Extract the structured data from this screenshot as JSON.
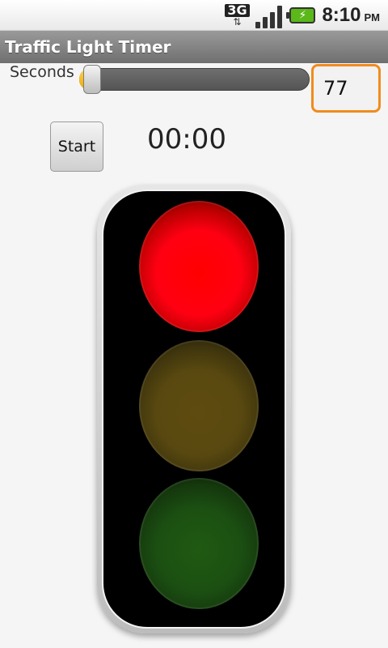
{
  "status_bar": {
    "network_type": "3G",
    "time": "8:10",
    "ampm": "PM",
    "icons": [
      "network-3g-icon",
      "signal-icon",
      "battery-charging-icon"
    ],
    "colors": {
      "battery": "#5ab818"
    }
  },
  "app": {
    "title": "Traffic Light Timer"
  },
  "controls": {
    "seconds_label": "Seconds",
    "seconds_value": "77",
    "slider_fraction": 0.02,
    "start_label": "Start",
    "timer_display": "00:00"
  },
  "traffic_light": {
    "active_lamp": "red",
    "lamps": [
      {
        "name": "red",
        "on": true,
        "color": "#ff0000"
      },
      {
        "name": "yellow",
        "on": false,
        "color": "#594910"
      },
      {
        "name": "green",
        "on": false,
        "color": "#1b4f12"
      }
    ]
  }
}
